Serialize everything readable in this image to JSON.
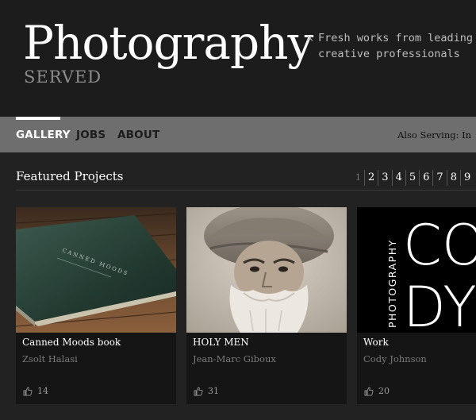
{
  "header": {
    "title": "Photography",
    "subtitle": "SERVED",
    "tagline_mark": "×",
    "tagline": "Fresh works from leading creative professionals"
  },
  "nav": {
    "items": [
      {
        "label": "GALLERY",
        "active": true
      },
      {
        "label": "JOBS",
        "active": false
      },
      {
        "label": "ABOUT",
        "active": false
      }
    ],
    "also_serving": "Also Serving:  In"
  },
  "section": {
    "title": "Featured Projects",
    "pages": [
      "1",
      "2",
      "3",
      "4",
      "5",
      "6",
      "7",
      "8",
      "9"
    ],
    "current_page": "1"
  },
  "projects": [
    {
      "title": "Canned Moods book",
      "author": "Zsolt Halasi",
      "appreciations": "14",
      "image": "green-book-on-wood-table"
    },
    {
      "title": "HOLY MEN",
      "author": "Jean-Marc Giboux",
      "appreciations": "31",
      "image": "bearded-man-in-turban-portrait"
    },
    {
      "title": "Work",
      "author": "Cody Johnson",
      "appreciations": "20",
      "image": "cody-photography-logo"
    }
  ],
  "cody_logo": {
    "word": "PHOTOGRAPHY",
    "top": "CO",
    "bottom": "DY"
  },
  "book_cover_text": "CANNED MOODS",
  "colors": {
    "header_bg": "#1c1c1c",
    "nav_bg": "#6e6e6e",
    "page_bg": "#222222",
    "card_bg": "#151515",
    "muted_text": "#7a7a7a"
  }
}
